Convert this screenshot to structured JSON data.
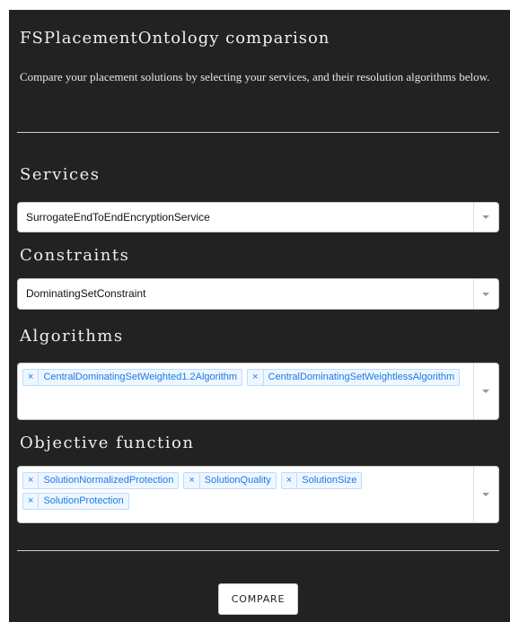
{
  "title": "FSPlacementOntology comparison",
  "description": "Compare your placement solutions by selecting your services, and their resolution algorithms below.",
  "services": {
    "label": "Services",
    "selected": "SurrogateEndToEndEncryptionService"
  },
  "constraints": {
    "label": "Constraints",
    "selected": "DominatingSetConstraint"
  },
  "algorithms": {
    "label": "Algorithms",
    "selected": [
      "CentralDominatingSetWeighted1.2Algorithm",
      "CentralDominatingSetWeightlessAlgorithm"
    ]
  },
  "objective": {
    "label": "Objective function",
    "selected": [
      "SolutionNormalizedProtection",
      "SolutionQuality",
      "SolutionSize",
      "SolutionProtection"
    ]
  },
  "tag_remove_glyph": "×",
  "compare_button": "COMPARE",
  "colors": {
    "panel": "#222222",
    "tag_text": "#1a7be6",
    "tag_bg": "#eef6ff",
    "tag_border": "#bcdcff"
  },
  "icons": {
    "dropdown": "chevron-down-icon",
    "remove": "close-icon"
  }
}
